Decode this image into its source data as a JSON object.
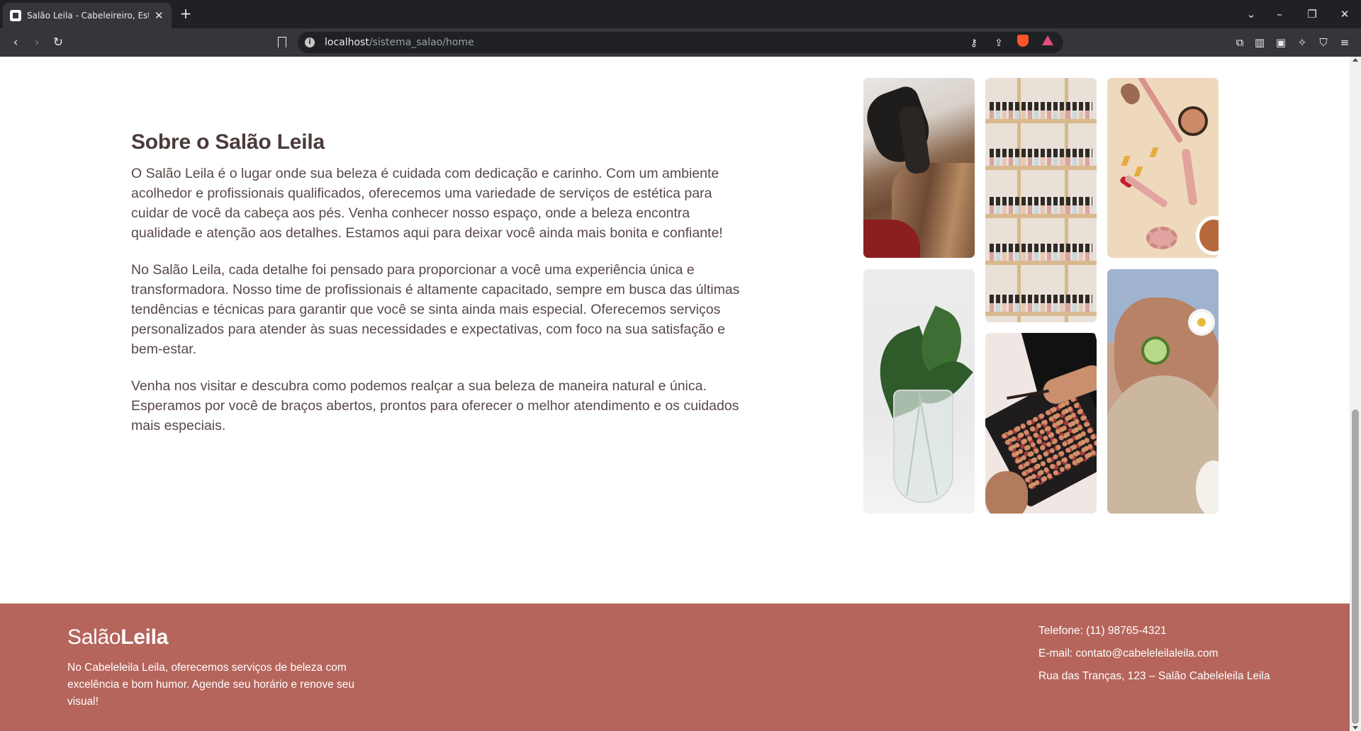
{
  "browser": {
    "tab_title": "Salão Leila - Cabeleireiro, Estét",
    "new_tab_symbol": "+",
    "url_host": "localhost",
    "url_path": "/sistema_salao/home"
  },
  "about": {
    "heading": "Sobre o Salão Leila",
    "paragraphs": [
      "O Salão Leila é o lugar onde sua beleza é cuidada com dedicação e carinho. Com um ambiente acolhedor e profissionais qualificados, oferecemos uma variedade de serviços de estética para cuidar de você da cabeça aos pés. Venha conhecer nosso espaço, onde a beleza encontra qualidade e atenção aos detalhes. Estamos aqui para deixar você ainda mais bonita e confiante!",
      "No Salão Leila, cada detalhe foi pensado para proporcionar a você uma experiência única e transformadora. Nosso time de profissionais é altamente capacitado, sempre em busca das últimas tendências e técnicas para garantir que você se sinta ainda mais especial. Oferecemos serviços personalizados para atender às suas necessidades e expectativas, com foco na sua satisfação e bem-estar.",
      "Venha nos visitar e descubra como podemos realçar a sua beleza de maneira natural e única. Esperamos por você de braços abertos, prontos para oferecer o melhor atendimento e os cuidados mais especiais."
    ]
  },
  "gallery": {
    "images": [
      "hair-styling-photo",
      "nail-polish-shelf-photo",
      "makeup-flatlay-photo",
      "plant-vase-photo",
      "eyeshadow-palette-photo",
      "spa-facial-photo"
    ]
  },
  "footer": {
    "brand_light": "Salão",
    "brand_bold": "Leila",
    "description": "No Cabeleleila Leila, oferecemos serviços de beleza com excelência e bom humor. Agende seu horário e renove seu visual!",
    "phone": "Telefone: (11) 98765-4321",
    "email": "E-mail: contato@cabeleleilaleila.com",
    "address": "Rua das Tranças, 123 – Salão Cabeleleila Leila",
    "bg_color": "#b5655b"
  },
  "colors": {
    "heading": "#4a3a3a",
    "body_text": "#5a4848",
    "footer": "#b5655b"
  }
}
